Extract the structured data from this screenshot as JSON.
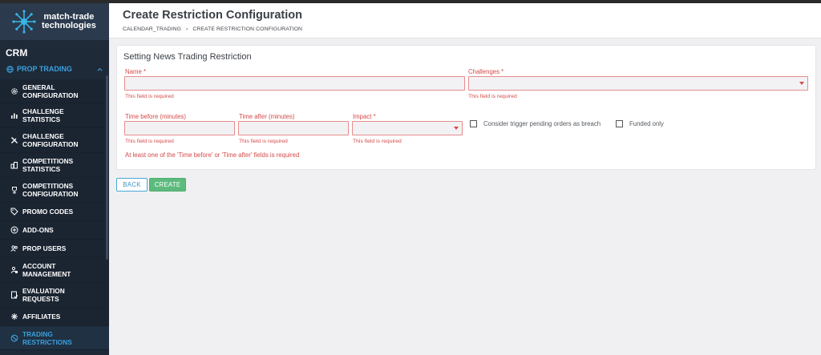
{
  "brand": {
    "line1": "match-trade",
    "line2": "technologies"
  },
  "sidebar": {
    "crm_label": "CRM",
    "section_label": "PROP TRADING",
    "items": [
      {
        "label_1": "GENERAL",
        "label_2": "CONFIGURATION",
        "icon": "gear-icon"
      },
      {
        "label_1": "CHALLENGE",
        "label_2": "STATISTICS",
        "icon": "bar-chart-icon"
      },
      {
        "label_1": "CHALLENGE",
        "label_2": "CONFIGURATION",
        "icon": "tools-icon"
      },
      {
        "label_1": "COMPETITIONS",
        "label_2": "STATISTICS",
        "icon": "buildings-icon"
      },
      {
        "label_1": "COMPETITIONS",
        "label_2": "CONFIGURATION",
        "icon": "trophy-icon"
      },
      {
        "label_1": "PROMO CODES",
        "label_2": "",
        "icon": "tag-icon"
      },
      {
        "label_1": "ADD-ONS",
        "label_2": "",
        "icon": "plus-circle-icon"
      },
      {
        "label_1": "PROP USERS",
        "label_2": "",
        "icon": "users-icon"
      },
      {
        "label_1": "ACCOUNT",
        "label_2": "MANAGEMENT",
        "icon": "account-lock-icon"
      },
      {
        "label_1": "EVALUATION",
        "label_2": "REQUESTS",
        "icon": "document-check-icon"
      },
      {
        "label_1": "AFFILIATES",
        "label_2": "",
        "icon": "network-icon"
      },
      {
        "label_1": "TRADING",
        "label_2": "RESTRICTIONS",
        "icon": "block-icon"
      }
    ]
  },
  "header": {
    "title": "Create Restriction Configuration",
    "breadcrumb": [
      "CALENDAR_TRADING",
      "›",
      "CREATE RESTRICTION CONFIGURATION"
    ]
  },
  "form": {
    "section_title": "Setting News Trading Restriction",
    "name_label": "Name *",
    "name_value": "",
    "challenges_label": "Challenges *",
    "challenges_value": "",
    "time_before_label": "Time before (minutes)",
    "time_before_value": "",
    "time_after_label": "Time after (minutes)",
    "time_after_value": "",
    "impact_label": "Impact *",
    "impact_value": "",
    "required_error": "This field is required",
    "pending_orders_label": "Consider trigger pending orders as breach",
    "funded_only_label": "Funded only",
    "time_note": "At least one of the 'Time before' or 'Time after' fields is required"
  },
  "actions": {
    "back_label": "BACK",
    "create_label": "CREATE"
  },
  "colors": {
    "sidebar_bg": "#1e2a38",
    "accent": "#3aa0e0",
    "error": "#d44a4a",
    "create": "#5cba7d"
  }
}
